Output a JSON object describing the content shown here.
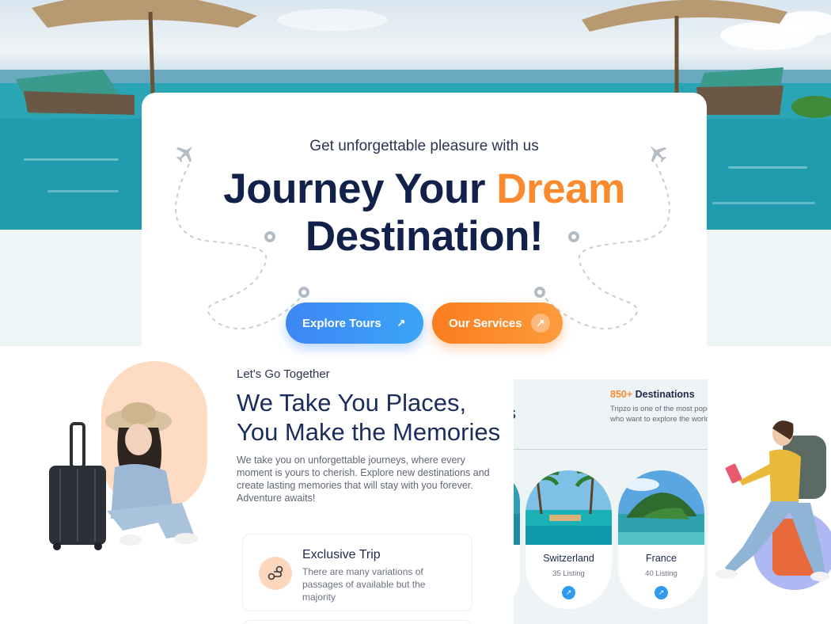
{
  "hero": {
    "subtitle": "Get unforgettable pleasure with us",
    "title_line1": "Journey Your ",
    "title_accent": "Dream",
    "title_line2": "Destination!",
    "btn_primary": "Explore Tours",
    "btn_secondary": "Our Services",
    "colors": {
      "accent": "#fb8a2e",
      "primary": "#3f86f5",
      "heading": "#12214a"
    }
  },
  "about": {
    "tag": "Let's Go Together",
    "title_line1": "We Take You Places,",
    "title_line2": "You Make the Memories",
    "text": "We take you on unforgettable journeys, where every moment is yours to cherish. Explore new destinations and create lasting memories that will stay with you forever. Adventure awaits!",
    "feature": {
      "icon": "route-icon",
      "title": "Exclusive Trip",
      "text": "There are many variations of passages of available but the majority"
    }
  },
  "destinations": {
    "cut_heading": "s",
    "count_num": "850+",
    "count_label": " Destinations",
    "desc_line1": "Tripzo is one of the most popu",
    "desc_line2": "who want to explore the world",
    "items": [
      {
        "name": "Switzerland",
        "listing": "35 Listing"
      },
      {
        "name": "France",
        "listing": "40 Listing"
      }
    ]
  }
}
